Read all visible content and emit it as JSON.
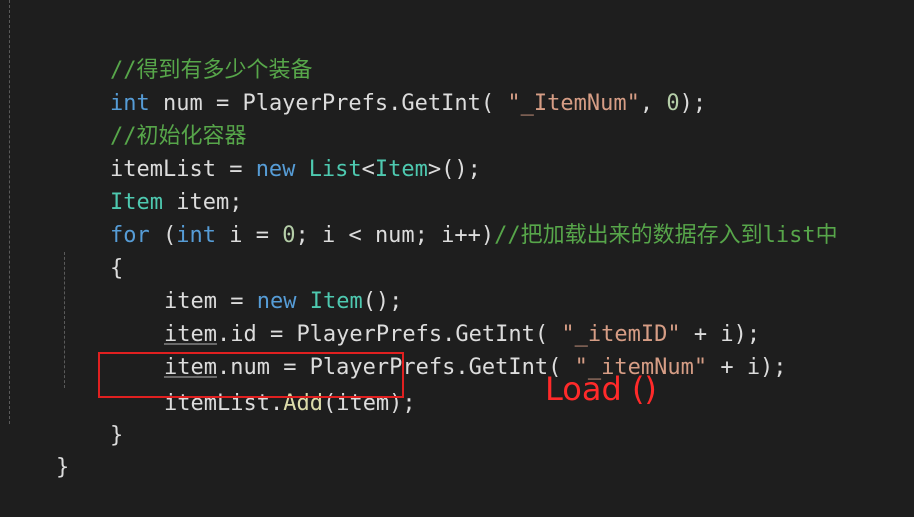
{
  "code": {
    "line1": {
      "comment": "//得到有多少个装备"
    },
    "line2": {
      "kw_int": "int",
      "var_name": " num = PlayerPrefs.",
      "method": "GetInt",
      "open": "( ",
      "string": "\"_ItemNum\"",
      "comma": ", ",
      "number": "0",
      "close": ");"
    },
    "line3": {
      "comment": "//初始化容器"
    },
    "line4": {
      "lhs": "itemList = ",
      "kw_new": "new",
      "sp": " ",
      "type": "List",
      "lt": "<",
      "type2": "Item",
      "gt": ">",
      "rest": "();"
    },
    "line5": {
      "type": "Item",
      "rest": " item;"
    },
    "line6": {
      "kw_for": "for",
      "open": " (",
      "kw_int": "int",
      "mid1": " i = ",
      "zero": "0",
      "mid2": "; i < num; i++)",
      "comment": "//把加载出来的数据存入到list中"
    },
    "line7": {
      "brace": "{"
    },
    "line8": {
      "lhs": "item = ",
      "kw_new": "new",
      "sp": " ",
      "type": "Item",
      "rest": "();"
    },
    "line9": {
      "obj": "item",
      "prop": ".id = PlayerPrefs.",
      "method": "GetInt",
      "open": "( ",
      "string": "\"_itemID\"",
      "rest": " + i);"
    },
    "line10": {
      "obj": "item",
      "prop": ".num = PlayerPrefs.",
      "method": "GetInt",
      "open": "( ",
      "string": "\"_itemNum\"",
      "rest": " + i);"
    },
    "line11": {
      "lhs": "itemList.",
      "method": "Add",
      "rest": "(item);"
    },
    "line12": {
      "brace": "}"
    },
    "line13": {
      "brace": "}"
    }
  },
  "annotation": {
    "label": "Load ()"
  },
  "colors": {
    "background": "#1e1e1e",
    "keyword": "#569cd6",
    "type": "#4ec9b0",
    "string": "#d69d85",
    "comment": "#57a64a",
    "highlight": "#e02020",
    "annotation": "#ff2a2a"
  }
}
